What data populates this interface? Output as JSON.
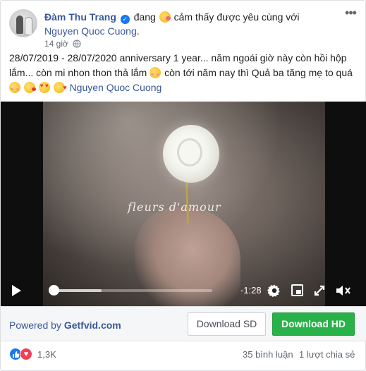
{
  "post": {
    "author": "Đàm Thu Trang",
    "feeling_prefix": "đang",
    "feeling_text": "cảm thấy được yêu cùng với",
    "tagged_person": "Nguyen Quoc Cuong",
    "tagged_suffix": ".",
    "time": "14 giờ",
    "text_main": "28/07/2019 - 28/07/2020 anniversary 1 year... năm ngoái giờ này còn hồi hộp lắm... còn mi nhon thon thả lắm",
    "text_middle": "còn tới năm nay thì Quả ba tăng mẹ to quá",
    "text_link": "Nguyen Quoc Cuong",
    "more_icon": "more-horizontal-icon",
    "privacy_icon": "globe-icon"
  },
  "video": {
    "caption": "fleurs d'amour",
    "time_remaining": "-1:28",
    "progress": 0.0,
    "buffered": 0.3,
    "icons": [
      "play-icon",
      "gear-icon",
      "quality-icon",
      "fullscreen-icon",
      "volume-icon"
    ]
  },
  "download": {
    "powered_prefix": "Powered by",
    "powered_brand": "Getfvid.com",
    "sd_label": "Download SD",
    "hd_label": "Download HD",
    "hd_color": "#29b24a"
  },
  "footer": {
    "reaction_count": "1,3K",
    "comments": "35 bình luận",
    "shares": "1 lượt chia sẻ"
  },
  "colors": {
    "link": "#385898",
    "like_blue": "#1877f2",
    "love_red": "#f33e58"
  }
}
